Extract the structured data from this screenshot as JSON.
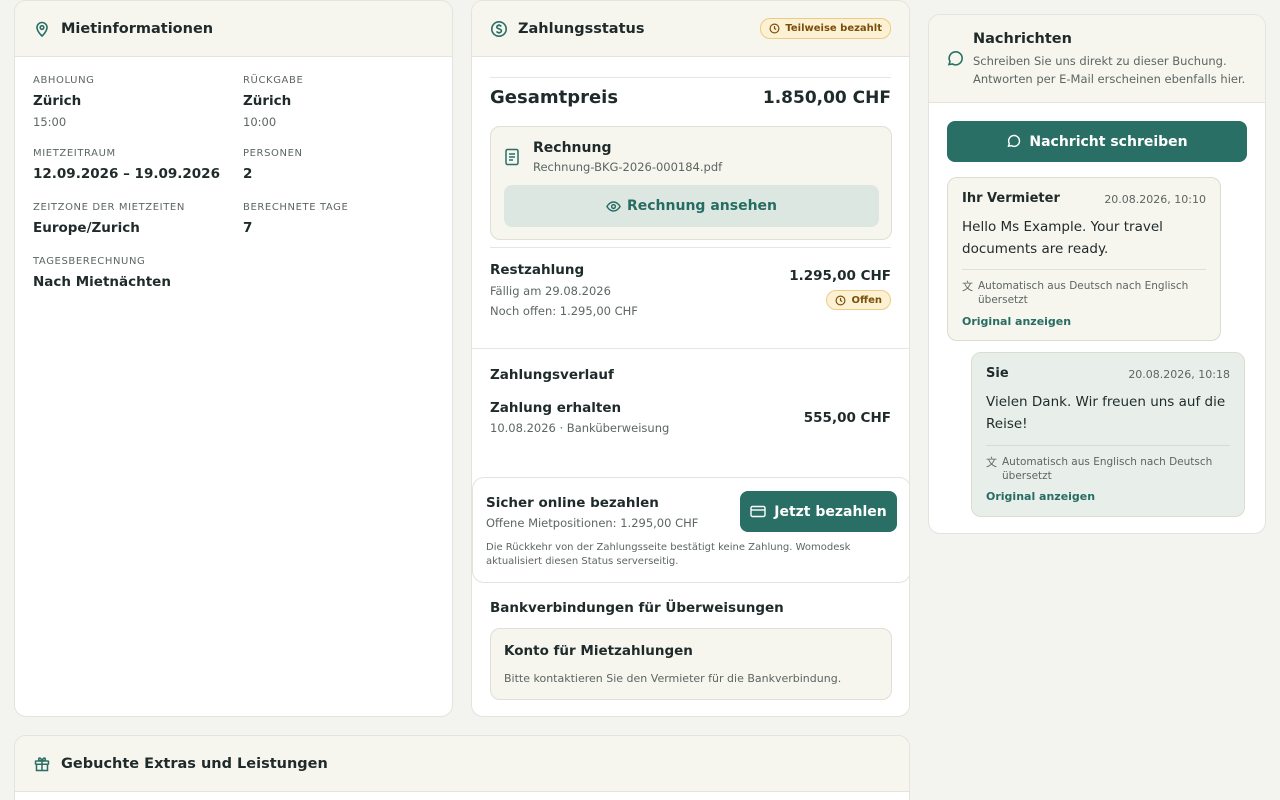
{
  "rental": {
    "title": "Mietinformationen",
    "pickup_label": "ABHOLUNG",
    "pickup_place": "Zürich",
    "pickup_time": "15:00",
    "return_label": "RÜCKGABE",
    "return_place": "Zürich",
    "return_time": "10:00",
    "period_label": "MIETZEITRAUM",
    "period_value": "12.09.2026 – 19.09.2026",
    "persons_label": "PERSONEN",
    "persons_value": "2",
    "timezone_label": "ZEITZONE DER MIETZEITEN",
    "timezone_value": "Europe/Zurich",
    "days_label": "BERECHNETE TAGE",
    "days_value": "7",
    "daycalc_label": "TAGESBERECHNUNG",
    "daycalc_value": "Nach Mietnächten"
  },
  "payment": {
    "title": "Zahlungsstatus",
    "status_badge": "Teilweise bezahlt",
    "total_label": "Gesamtpreis",
    "total_value": "1.850,00 CHF",
    "invoice_title": "Rechnung",
    "invoice_file": "Rechnung-BKG-2026-000184.pdf",
    "invoice_button": "Rechnung ansehen",
    "rest_label": "Restzahlung",
    "rest_due": "Fällig am 29.08.2026",
    "rest_open": "Noch offen: 1.295,00 CHF",
    "rest_value": "1.295,00 CHF",
    "rest_badge": "Offen",
    "history_title": "Zahlungsverlauf",
    "history_item_label": "Zahlung erhalten",
    "history_item_meta": "10.08.2026 · Banküberweisung",
    "history_item_value": "555,00 CHF",
    "secure_title": "Sicher online bezahlen",
    "secure_open": "Offene Mietpositionen: 1.295,00 CHF",
    "secure_button": "Jetzt bezahlen",
    "secure_note": "Die Rückkehr von der Zahlungsseite bestätigt keine Zahlung. Womodesk aktualisiert diesen Status serverseitig.",
    "bank_title": "Bankverbindungen für Überweisungen",
    "bank_box_title": "Konto für Mietzahlungen",
    "bank_box_text": "Bitte kontaktieren Sie den Vermieter für die Bankverbindung."
  },
  "messages": {
    "title": "Nachrichten",
    "subtitle": "Schreiben Sie uns direkt zu dieser Buchung. Antworten per E-Mail erscheinen ebenfalls hier.",
    "write_button": "Nachricht schreiben",
    "items": [
      {
        "author": "Ihr Vermieter",
        "time": "20.08.2026, 10:10",
        "text": "Hello Ms Example. Your travel documents are ready.",
        "translation": "Automatisch aus Deutsch nach Englisch übersetzt",
        "show_original": "Original anzeigen"
      },
      {
        "author": "Sie",
        "time": "20.08.2026, 10:18",
        "text": "Vielen Dank. Wir freuen uns auf die Reise!",
        "translation": "Automatisch aus Englisch nach Deutsch übersetzt",
        "show_original": "Original anzeigen"
      }
    ]
  },
  "extras": {
    "title": "Gebuchte Extras und Leistungen"
  },
  "colors": {
    "accent": "#2a6f65",
    "badge_bg": "#fdf1d4",
    "badge_text": "#7a4f09",
    "card_header_bg": "#f6f5ee"
  }
}
